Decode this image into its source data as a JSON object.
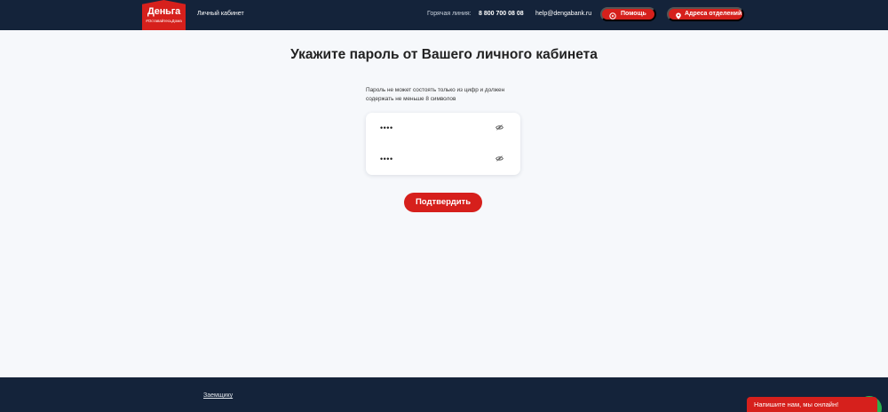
{
  "header": {
    "logo": {
      "brand": "Деньга",
      "tagline": "#ОставайтесьДома"
    },
    "cabinet_link": "Личный кабинет",
    "hotline_label": "Горячая линия:",
    "phone": "8 800 700 08 08",
    "email": "help@dengabank.ru",
    "help_button": "Помощь",
    "address_button": "Адреса отделений",
    "help_icon": "help-circle-icon",
    "address_icon": "map-pin-icon"
  },
  "main": {
    "title": "Укажите пароль от Вашего личного кабинета",
    "hint": "Пароль не может состоять только из цифр и должен содержать не меньше 8 символов",
    "password_value": "••••",
    "password_confirm_value": "••••",
    "eye_icon": "eye-hidden-icon",
    "submit_label": "Подтвердить"
  },
  "footer": {
    "link": "Заемщику"
  },
  "chat": {
    "label": "Напишите нам, мы онлайн!"
  },
  "colors": {
    "brand_red": "#d6201c",
    "header_navy": "#14233a",
    "page_bg": "#f6f8fb",
    "chat_green": "#2bb24c"
  }
}
